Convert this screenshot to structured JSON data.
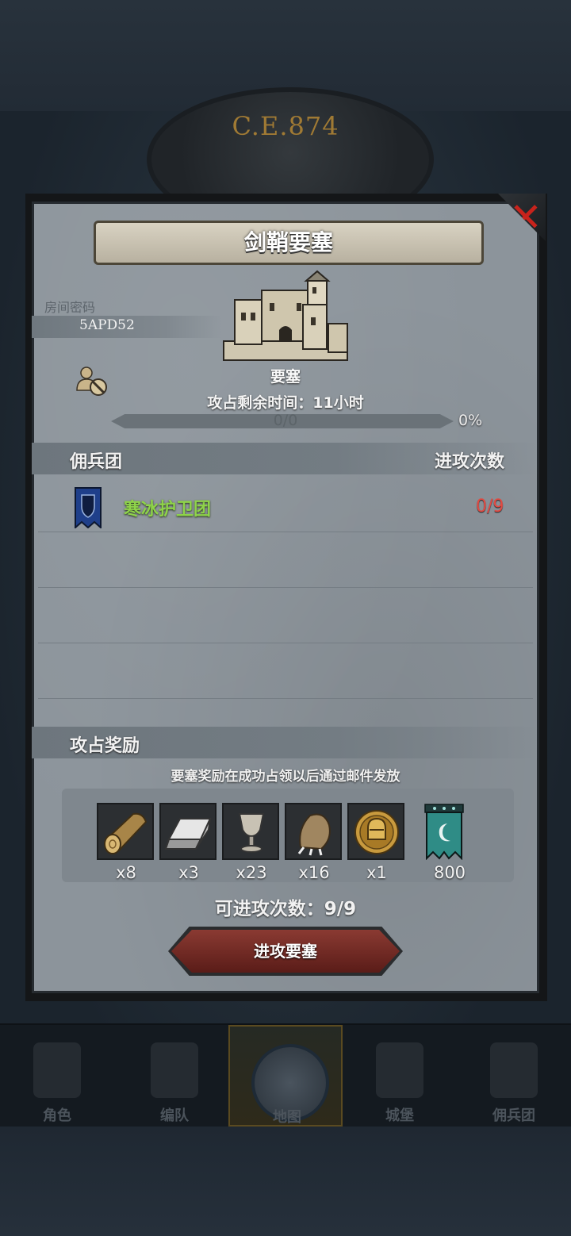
{
  "background": {
    "era_label": "C.E.874"
  },
  "bottom_nav": {
    "tabs": [
      {
        "label": "角色"
      },
      {
        "label": "编队"
      },
      {
        "label": "地图"
      },
      {
        "label": "城堡"
      },
      {
        "label": "佣兵团"
      }
    ],
    "active_tab": "地图"
  },
  "dialog": {
    "title": "剑鞘要塞",
    "room_code_label": "房间密码",
    "room_code": "5APD52",
    "fortress_label": "要塞",
    "capture_time": "攻占剩余时间：11小时",
    "progress": {
      "text": "0/0",
      "percent_text": "0%",
      "fraction": 0
    },
    "mercenary_section": {
      "title": "佣兵团",
      "attack_count_label": "进攻次数",
      "rows": [
        {
          "name": "寒冰护卫团",
          "count": "0/9"
        }
      ]
    },
    "reward_section": {
      "title": "攻占奖励",
      "note": "要塞奖励在成功占领以后通过邮件发放",
      "items": [
        {
          "icon": "wood-log-icon",
          "qty": "x8"
        },
        {
          "icon": "iron-ingot-icon",
          "qty": "x3"
        },
        {
          "icon": "goblet-icon",
          "qty": "x23"
        },
        {
          "icon": "beast-claw-icon",
          "qty": "x16"
        },
        {
          "icon": "knight-helmet-medal-icon",
          "qty": "x1"
        },
        {
          "icon": "moon-banner-icon",
          "qty": "800"
        }
      ]
    },
    "attacks_remaining": "可进攻次数：9/9",
    "attack_button": "进攻要塞"
  },
  "colors": {
    "mercenary_name": "#8ed34a",
    "attack_count": "#e34a42",
    "close_x": "#c8231c",
    "panel": "#8c949b"
  }
}
